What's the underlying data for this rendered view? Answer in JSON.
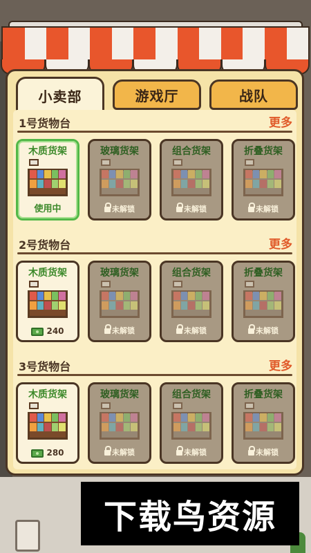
{
  "tabs": [
    {
      "label": "小卖部",
      "active": true
    },
    {
      "label": "游戏厅",
      "active": false
    },
    {
      "label": "战队",
      "active": false
    }
  ],
  "more_label": "更多",
  "sections": [
    {
      "title": "1号货物台",
      "cards": [
        {
          "name": "木质货架",
          "status": "使用中",
          "state": "active"
        },
        {
          "name": "玻璃货架",
          "status": "未解锁",
          "state": "locked"
        },
        {
          "name": "组合货架",
          "status": "未解锁",
          "state": "locked"
        },
        {
          "name": "折叠货架",
          "status": "未解锁",
          "state": "locked"
        }
      ]
    },
    {
      "title": "2号货物台",
      "cards": [
        {
          "name": "木质货架",
          "status": "240",
          "state": "buy"
        },
        {
          "name": "玻璃货架",
          "status": "未解锁",
          "state": "locked"
        },
        {
          "name": "组合货架",
          "status": "未解锁",
          "state": "locked"
        },
        {
          "name": "折叠货架",
          "status": "未解锁",
          "state": "locked"
        }
      ]
    },
    {
      "title": "3号货物台",
      "cards": [
        {
          "name": "木质货架",
          "status": "280",
          "state": "buy"
        },
        {
          "name": "玻璃货架",
          "status": "未解锁",
          "state": "locked"
        },
        {
          "name": "组合货架",
          "status": "未解锁",
          "state": "locked"
        },
        {
          "name": "折叠货架",
          "status": "未解锁",
          "state": "locked"
        }
      ]
    }
  ],
  "watermark": "下载鸟资源",
  "colors": {
    "accent_more": "#e05a2a",
    "active_border": "#52b848",
    "panel": "#f5e3a8"
  }
}
